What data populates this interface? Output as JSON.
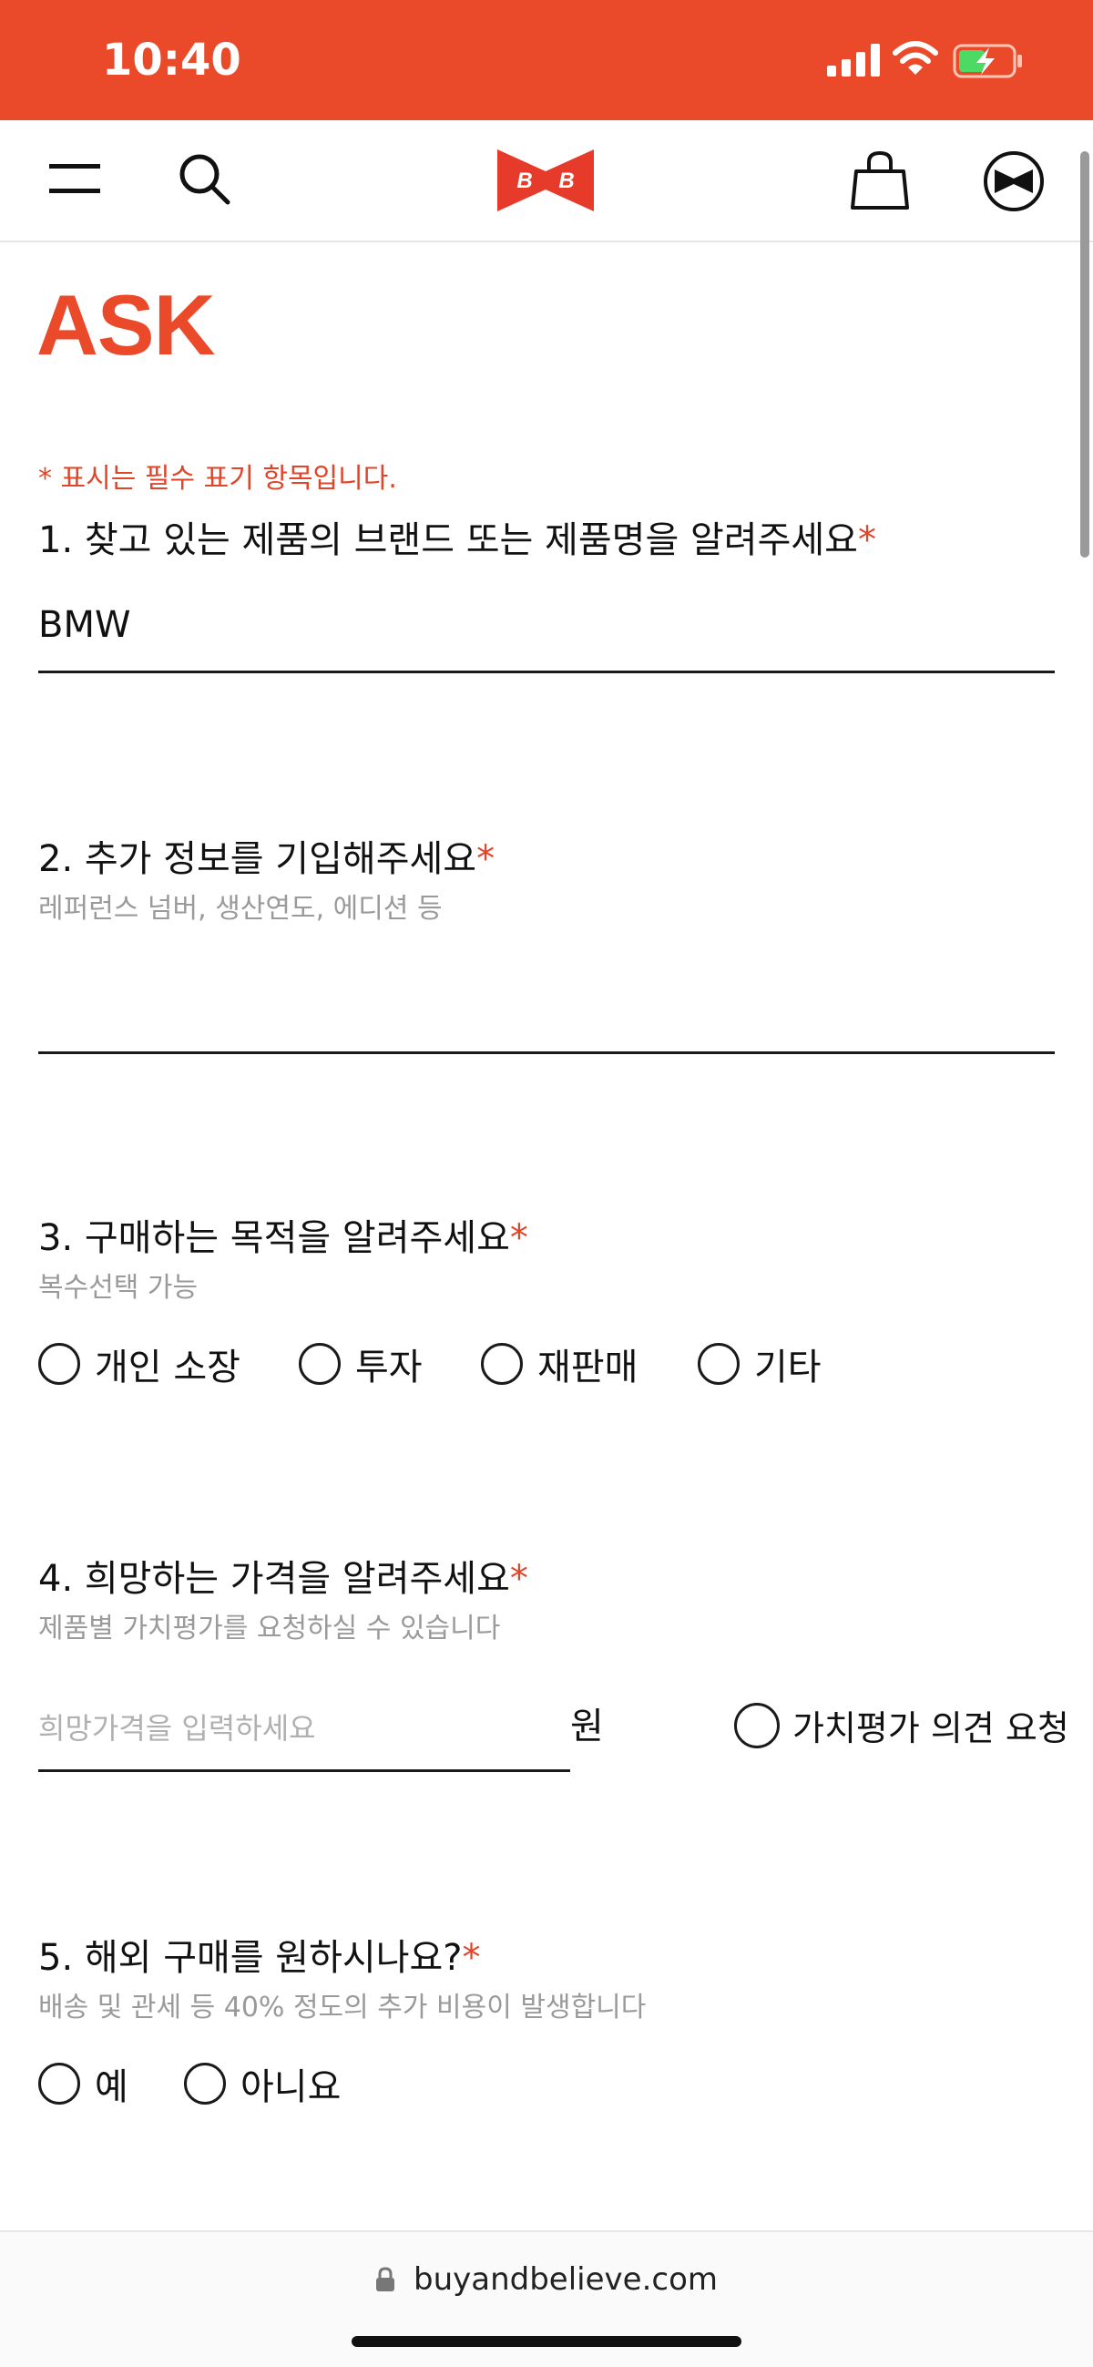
{
  "status_bar": {
    "time": "10:40"
  },
  "page": {
    "title": "ASK",
    "required_note": "* 표시는 필수 표기 항목입니다."
  },
  "q1": {
    "label": "1. 찾고 있는 제품의 브랜드 또는 제품명을 알려주세요",
    "value": "BMW"
  },
  "q2": {
    "label": "2. 추가 정보를 기입해주세요",
    "hint": "레퍼런스 넘버, 생산연도, 에디션 등",
    "value": ""
  },
  "q3": {
    "label": "3. 구매하는 목적을 알려주세요",
    "hint": "복수선택 가능",
    "options": [
      "개인 소장",
      "투자",
      "재판매",
      "기타"
    ]
  },
  "q4": {
    "label": "4. 희망하는 가격을 알려주세요",
    "hint": "제품별 가치평가를 요청하실 수 있습니다",
    "placeholder": "희망가격을 입력하세요",
    "unit": "원",
    "appraisal_option": "가치평가 의견 요청"
  },
  "q5": {
    "label": "5. 해외 구매를 원하시나요?",
    "hint": "배송 및 관세 등 40% 정도의 추가 비용이 발생합니다",
    "options": [
      "예",
      "아니요"
    ]
  },
  "required_mark": "*",
  "browser": {
    "url": "buyandbelieve.com"
  },
  "colors": {
    "brand": "#ea4a2a",
    "required": "#e0452a",
    "hint": "#9a9a9a"
  },
  "icons": {
    "menu": "menu-icon",
    "search": "search-icon",
    "logo": "bowtie-logo",
    "cart": "shopping-bag-icon",
    "account": "bowtie-account-icon",
    "lock": "lock-icon"
  }
}
